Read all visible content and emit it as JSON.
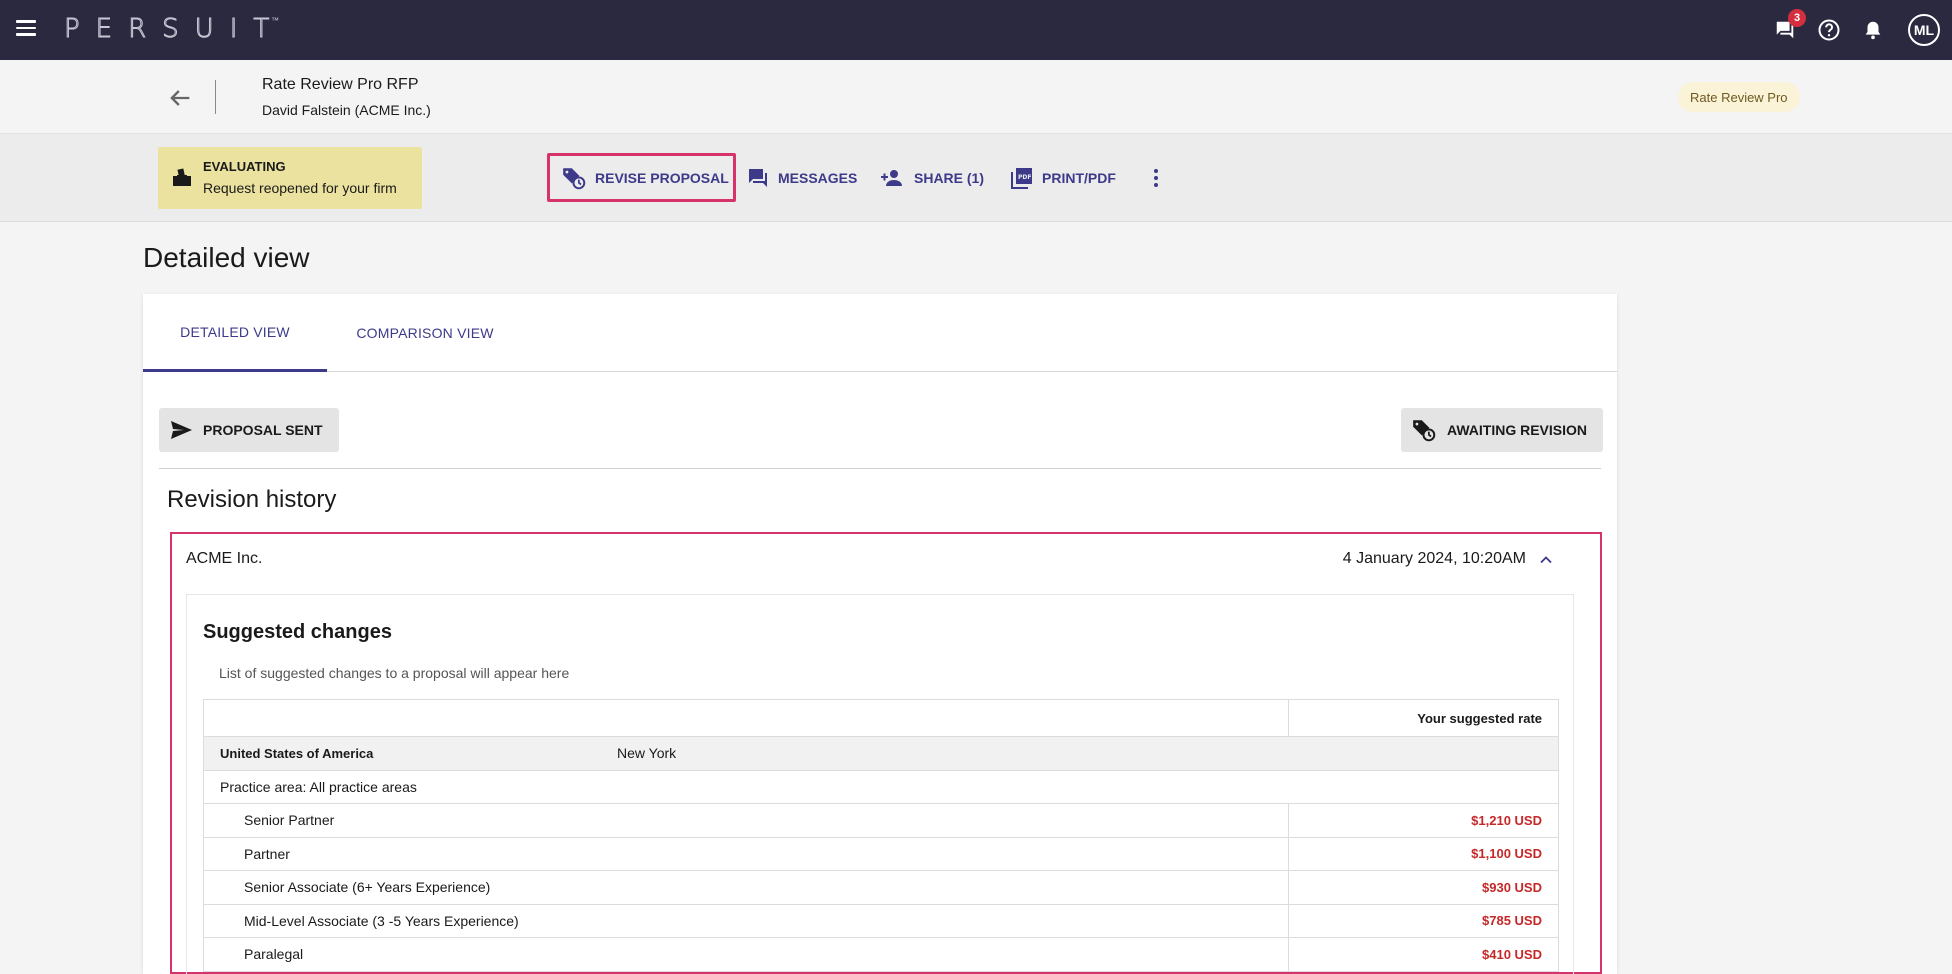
{
  "appbar": {
    "logo": "PERSUIT",
    "logo_tm": "™",
    "messages_badge": "3",
    "avatar_initials": "ML",
    "icons": [
      "menu-icon",
      "chat-icon",
      "help-icon",
      "bell-icon"
    ]
  },
  "header": {
    "rfp_title": "Rate Review Pro RFP",
    "rfp_subtitle": "David Falstein (ACME Inc.)",
    "chip": "Rate Review Pro"
  },
  "toolbar": {
    "status_title": "EVALUATING",
    "status_sub": "Request reopened for your firm",
    "revise": "REVISE PROPOSAL",
    "messages": "MESSAGES",
    "share": "SHARE (1)",
    "print": "PRINT/PDF"
  },
  "page": {
    "title": "Detailed view"
  },
  "tabs": [
    {
      "label": "DETAILED VIEW",
      "active": true
    },
    {
      "label": "COMPARISON VIEW",
      "active": false
    }
  ],
  "actions": {
    "proposal_sent": "PROPOSAL SENT",
    "awaiting_revision": "AWAITING REVISION"
  },
  "revision": {
    "title": "Revision history",
    "firm": "ACME Inc.",
    "date": "4 January 2024, 10:20AM",
    "suggested_title": "Suggested changes",
    "suggested_sub": "List of suggested changes to a proposal will appear here",
    "table": {
      "rate_header": "Your suggested rate",
      "country": "United States of America",
      "city": "New York",
      "practice_area": "Practice area: All practice areas",
      "rows": [
        {
          "role": "Senior Partner",
          "rate": "$1,210 USD"
        },
        {
          "role": "Partner",
          "rate": "$1,100 USD"
        },
        {
          "role": "Senior Associate (6+ Years Experience)",
          "rate": "$930 USD"
        },
        {
          "role": "Mid-Level Associate (3 -5 Years Experience)",
          "rate": "$785 USD"
        },
        {
          "role": "Paralegal",
          "rate": "$410 USD"
        }
      ]
    }
  },
  "colors": {
    "appbar": "#2a2940",
    "accent": "#3d3a8a",
    "highlight": "#d6336c",
    "status_bg": "#ebe29f",
    "rate_red": "#c62828"
  }
}
